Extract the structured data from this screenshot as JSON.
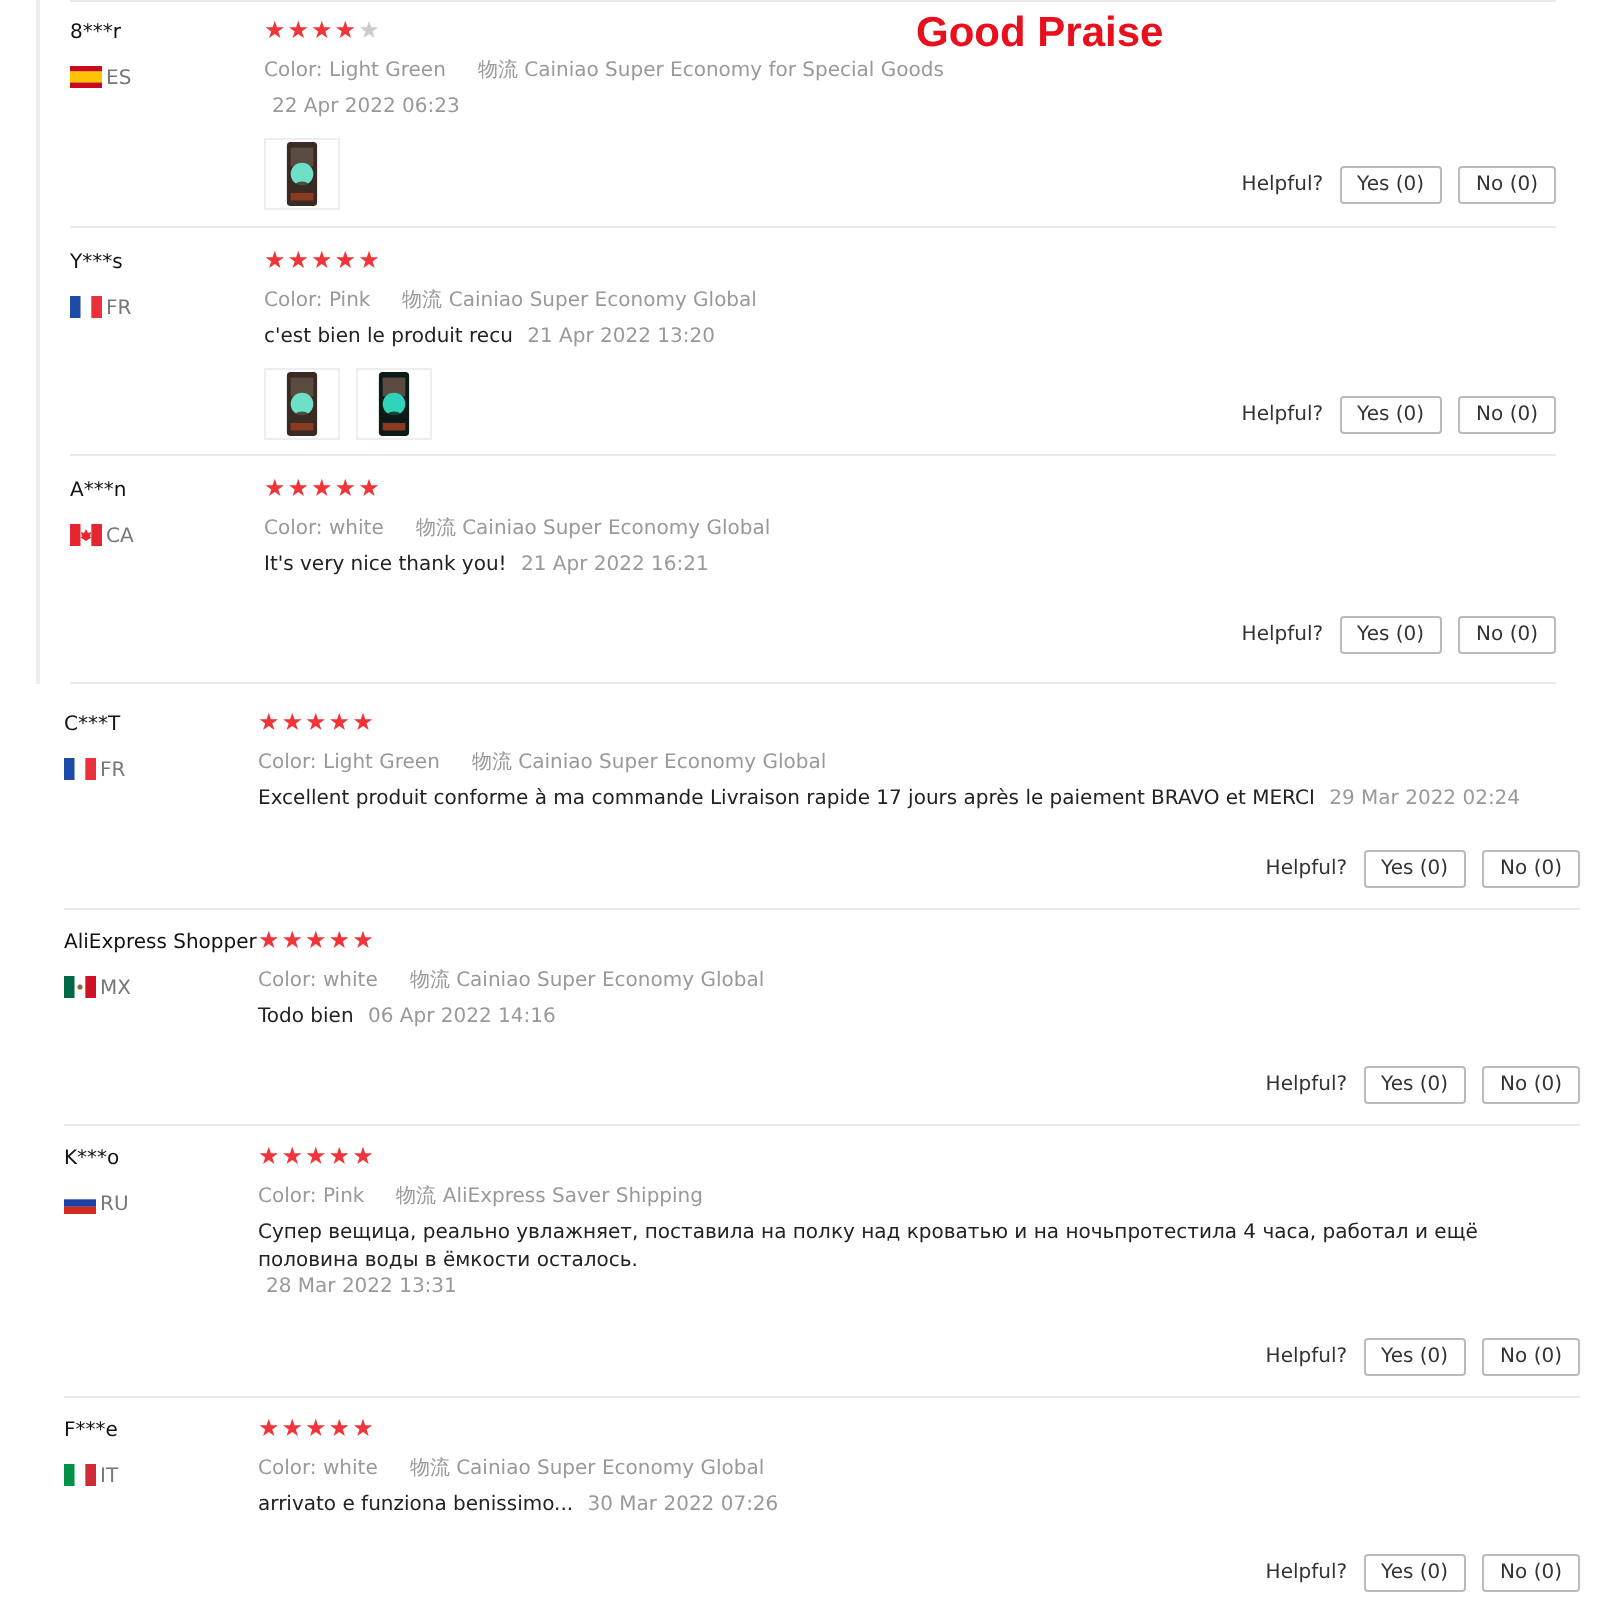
{
  "title": "Good Praise",
  "panels": [
    {
      "reviews": [
        {
          "name": "8***r",
          "country": "ES",
          "flag": {
            "kind": "spain"
          },
          "stars": 4,
          "color_label": "Color:",
          "color_value": "Light Green",
          "shipping_label": "物流",
          "shipping": "Cainiao Super Economy for Special Goods",
          "date": "22 Apr 2022 06:23",
          "photos": [
            {
              "kind": "picture"
            }
          ],
          "helpful": "Helpful?",
          "yes": "Yes (0)",
          "no": "No (0)"
        },
        {
          "name": "Y***s",
          "country": "FR",
          "flag": {
            "kind": "france"
          },
          "stars": 5,
          "color_label": "Color:",
          "color_value": "Pink",
          "shipping_label": "物流",
          "shipping": "Cainiao Super Economy Global",
          "comment": "c'est bien le produit recu",
          "date": "21 Apr 2022 13:20",
          "photos": [
            {
              "kind": "picture"
            },
            {
              "kind": "picture"
            }
          ],
          "helpful": "Helpful?",
          "yes": "Yes (0)",
          "no": "No (0)"
        },
        {
          "name": "A***n",
          "country": "CA",
          "flag": {
            "kind": "canada"
          },
          "stars": 5,
          "color_label": "Color:",
          "color_value": "white",
          "shipping_label": "物流",
          "shipping": "Cainiao Super Economy Global",
          "comment": "It's very nice thank you!",
          "date": "21 Apr 2022 16:21",
          "helpful": "Helpful?",
          "yes": "Yes (0)",
          "no": "No (0)"
        }
      ]
    },
    {
      "reviews": [
        {
          "name": "C***T",
          "country": "FR",
          "flag": {
            "kind": "france"
          },
          "stars": 5,
          "color_label": "Color:",
          "color_value": "Light Green",
          "shipping_label": "物流",
          "shipping": "Cainiao Super Economy Global",
          "comment": "Excellent produit conforme à ma commande Livraison rapide 17 jours après le paiement BRAVO et MERCI",
          "date": "29 Mar 2022 02:24",
          "helpful": "Helpful?",
          "yes": "Yes (0)",
          "no": "No (0)"
        },
        {
          "name": "AliExpress Shopper",
          "country": "MX",
          "flag": {
            "kind": "mexico"
          },
          "stars": 5,
          "color_label": "Color:",
          "color_value": "white",
          "shipping_label": "物流",
          "shipping": "Cainiao Super Economy Global",
          "comment": "Todo bien",
          "date": "06 Apr 2022 14:16",
          "helpful": "Helpful?",
          "yes": "Yes (0)",
          "no": "No (0)"
        },
        {
          "name": "K***o",
          "country": "RU",
          "flag": {
            "kind": "russia"
          },
          "stars": 5,
          "color_label": "Color:",
          "color_value": "Pink",
          "shipping_label": "物流",
          "shipping": "AliExpress Saver Shipping",
          "comment": "Супер вещица, реально увлажняет, поставила на полку над кроватью и на ночьпротестила 4 часа, работал и ещё половина воды в ёмкости осталось.",
          "date": "28 Mar 2022 13:31",
          "helpful": "Helpful?",
          "yes": "Yes (0)",
          "no": "No (0)"
        },
        {
          "name": "F***e",
          "country": "IT",
          "flag": {
            "kind": "italy"
          },
          "stars": 5,
          "color_label": "Color:",
          "color_value": "white",
          "shipping_label": "物流",
          "shipping": "Cainiao Super Economy Global",
          "comment": "arrivato e funziona benissimo...",
          "date": "30 Mar 2022 07:26",
          "helpful": "Helpful?",
          "yes": "Yes (0)",
          "no": "No (0)"
        }
      ]
    }
  ]
}
